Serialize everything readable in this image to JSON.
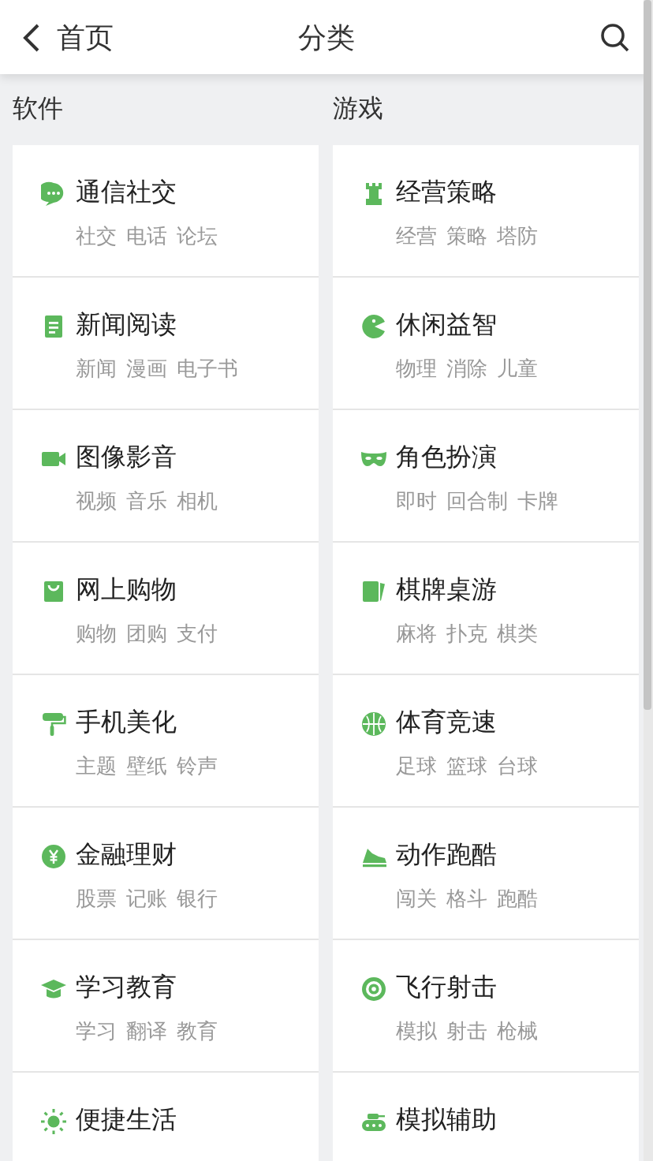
{
  "header": {
    "back_label": "首页",
    "title": "分类"
  },
  "columns": [
    {
      "title": "软件",
      "items": [
        {
          "name": "通信社交",
          "tags": [
            "社交",
            "电话",
            "论坛"
          ]
        },
        {
          "name": "新闻阅读",
          "tags": [
            "新闻",
            "漫画",
            "电子书"
          ]
        },
        {
          "name": "图像影音",
          "tags": [
            "视频",
            "音乐",
            "相机"
          ]
        },
        {
          "name": "网上购物",
          "tags": [
            "购物",
            "团购",
            "支付"
          ]
        },
        {
          "name": "手机美化",
          "tags": [
            "主题",
            "壁纸",
            "铃声"
          ]
        },
        {
          "name": "金融理财",
          "tags": [
            "股票",
            "记账",
            "银行"
          ]
        },
        {
          "name": "学习教育",
          "tags": [
            "学习",
            "翻译",
            "教育"
          ]
        },
        {
          "name": "便捷生活"
        }
      ]
    },
    {
      "title": "游戏",
      "items": [
        {
          "name": "经营策略",
          "tags": [
            "经营",
            "策略",
            "塔防"
          ]
        },
        {
          "name": "休闲益智",
          "tags": [
            "物理",
            "消除",
            "儿童"
          ]
        },
        {
          "name": "角色扮演",
          "tags": [
            "即时",
            "回合制",
            "卡牌"
          ]
        },
        {
          "name": "棋牌桌游",
          "tags": [
            "麻将",
            "扑克",
            "棋类"
          ]
        },
        {
          "name": "体育竞速",
          "tags": [
            "足球",
            "篮球",
            "台球"
          ]
        },
        {
          "name": "动作跑酷",
          "tags": [
            "闯关",
            "格斗",
            "跑酷"
          ]
        },
        {
          "name": "飞行射击",
          "tags": [
            "模拟",
            "射击",
            "枪械"
          ]
        },
        {
          "name": "模拟辅助"
        }
      ]
    }
  ]
}
